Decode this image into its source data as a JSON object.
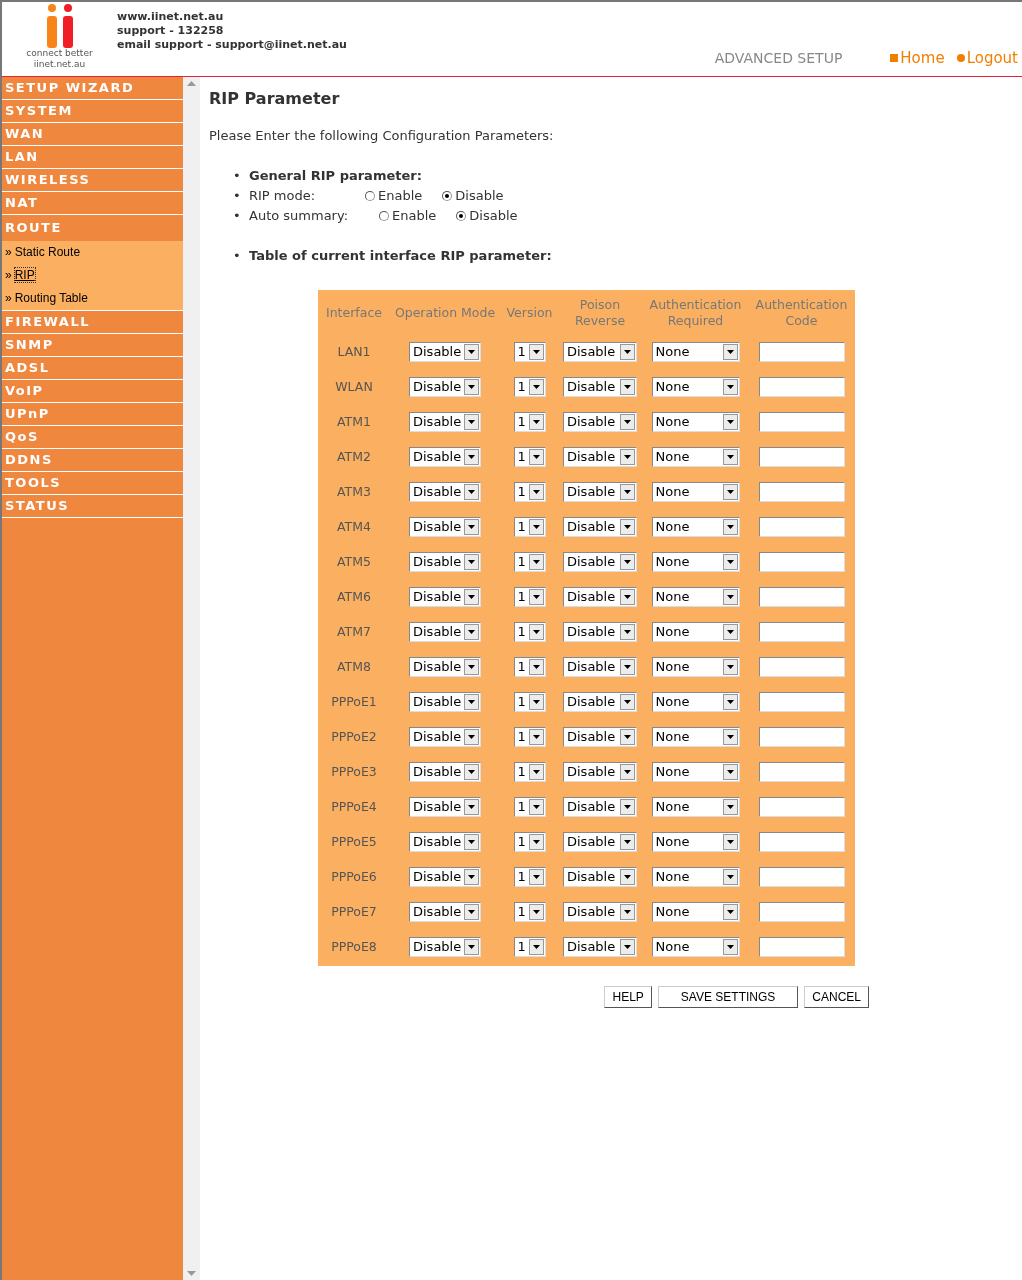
{
  "header": {
    "logo_caption": "connect better",
    "logo_domain": "iinet.net.au",
    "contact_lines": [
      "www.iinet.net.au",
      "support - 132258",
      "email support - support@iinet.net.au"
    ],
    "section_title": "ADVANCED SETUP",
    "links": [
      {
        "label": "Home"
      },
      {
        "label": "Logout"
      }
    ]
  },
  "sidebar": {
    "items": [
      {
        "label": "SETUP WIZARD",
        "selected": false
      },
      {
        "label": "SYSTEM",
        "selected": false
      },
      {
        "label": "WAN",
        "selected": false
      },
      {
        "label": "LAN",
        "selected": false
      },
      {
        "label": "WIRELESS",
        "selected": false
      },
      {
        "label": "NAT",
        "selected": false
      },
      {
        "label": "ROUTE",
        "selected": true,
        "children": [
          {
            "prefix": "»",
            "label": "Static Route",
            "selected": false
          },
          {
            "prefix": "»",
            "label": "RIP",
            "selected": true
          },
          {
            "prefix": "»",
            "label": "Routing Table",
            "selected": false
          }
        ]
      },
      {
        "label": "FIREWALL",
        "selected": false
      },
      {
        "label": "SNMP",
        "selected": false
      },
      {
        "label": "ADSL",
        "selected": false
      },
      {
        "label": "VoIP",
        "selected": false
      },
      {
        "label": "UPnP",
        "selected": false
      },
      {
        "label": "QoS",
        "selected": false
      },
      {
        "label": "DDNS",
        "selected": false
      },
      {
        "label": "TOOLS",
        "selected": false
      },
      {
        "label": "STATUS",
        "selected": false
      }
    ]
  },
  "page": {
    "title": "RIP Parameter",
    "intro": "Please Enter the following Configuration Parameters:",
    "general_heading": {
      "bullet": "•",
      "label": "General RIP parameter:"
    },
    "settings": [
      {
        "bullet": "•",
        "label": "RIP mode:",
        "options": [
          {
            "label": "Enable",
            "selected": false
          },
          {
            "label": "Disable",
            "selected": true
          }
        ]
      },
      {
        "bullet": "•",
        "label": "Auto summary:",
        "options": [
          {
            "label": "Enable",
            "selected": false
          },
          {
            "label": "Disable",
            "selected": true
          }
        ]
      }
    ],
    "table_heading": {
      "bullet": "•",
      "label": "Table of current interface RIP parameter:"
    }
  },
  "table": {
    "columns": [
      "Interface",
      "Operation Mode",
      "Version",
      "Poison Reverse",
      "Authentication Required",
      "Authentication Code"
    ],
    "rows": [
      {
        "interface": "LAN1",
        "mode": "Disable",
        "version": "1",
        "poison": "Disable",
        "auth": "None"
      },
      {
        "interface": "WLAN",
        "mode": "Disable",
        "version": "1",
        "poison": "Disable",
        "auth": "None"
      },
      {
        "interface": "ATM1",
        "mode": "Disable",
        "version": "1",
        "poison": "Disable",
        "auth": "None"
      },
      {
        "interface": "ATM2",
        "mode": "Disable",
        "version": "1",
        "poison": "Disable",
        "auth": "None"
      },
      {
        "interface": "ATM3",
        "mode": "Disable",
        "version": "1",
        "poison": "Disable",
        "auth": "None"
      },
      {
        "interface": "ATM4",
        "mode": "Disable",
        "version": "1",
        "poison": "Disable",
        "auth": "None"
      },
      {
        "interface": "ATM5",
        "mode": "Disable",
        "version": "1",
        "poison": "Disable",
        "auth": "None"
      },
      {
        "interface": "ATM6",
        "mode": "Disable",
        "version": "1",
        "poison": "Disable",
        "auth": "None"
      },
      {
        "interface": "ATM7",
        "mode": "Disable",
        "version": "1",
        "poison": "Disable",
        "auth": "None"
      },
      {
        "interface": "ATM8",
        "mode": "Disable",
        "version": "1",
        "poison": "Disable",
        "auth": "None"
      },
      {
        "interface": "PPPoE1",
        "mode": "Disable",
        "version": "1",
        "poison": "Disable",
        "auth": "None"
      },
      {
        "interface": "PPPoE2",
        "mode": "Disable",
        "version": "1",
        "poison": "Disable",
        "auth": "None"
      },
      {
        "interface": "PPPoE3",
        "mode": "Disable",
        "version": "1",
        "poison": "Disable",
        "auth": "None"
      },
      {
        "interface": "PPPoE4",
        "mode": "Disable",
        "version": "1",
        "poison": "Disable",
        "auth": "None"
      },
      {
        "interface": "PPPoE5",
        "mode": "Disable",
        "version": "1",
        "poison": "Disable",
        "auth": "None"
      },
      {
        "interface": "PPPoE6",
        "mode": "Disable",
        "version": "1",
        "poison": "Disable",
        "auth": "None"
      },
      {
        "interface": "PPPoE7",
        "mode": "Disable",
        "version": "1",
        "poison": "Disable",
        "auth": "None"
      },
      {
        "interface": "PPPoE8",
        "mode": "Disable",
        "version": "1",
        "poison": "Disable",
        "auth": "None"
      }
    ]
  },
  "buttons": [
    "HELP",
    "SAVE SETTINGS",
    "CANCEL"
  ]
}
